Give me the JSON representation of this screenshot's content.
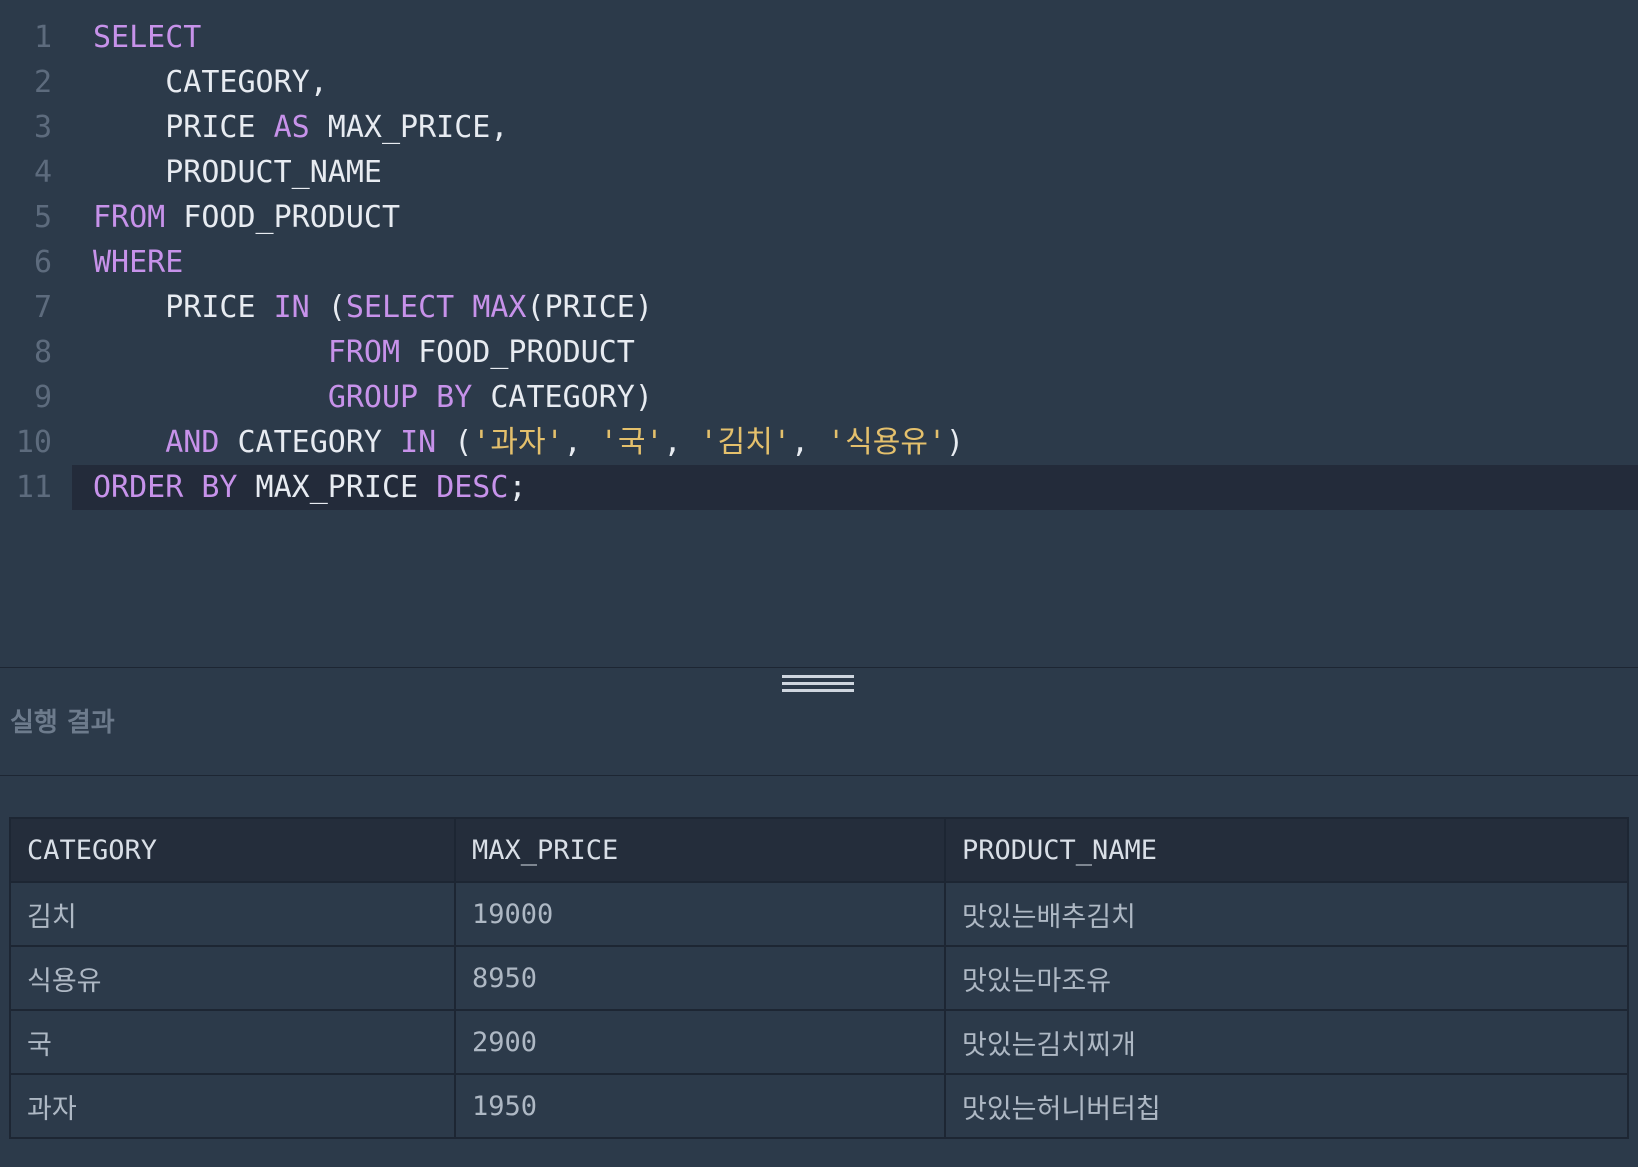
{
  "editor": {
    "lines": [
      {
        "no": "1",
        "tokens": [
          {
            "t": "SELECT",
            "k": "kw"
          }
        ]
      },
      {
        "no": "2",
        "tokens": [
          {
            "t": "    CATEGORY,",
            "k": "plain"
          }
        ]
      },
      {
        "no": "3",
        "tokens": [
          {
            "t": "    PRICE ",
            "k": "plain"
          },
          {
            "t": "AS",
            "k": "kw"
          },
          {
            "t": " MAX_PRICE,",
            "k": "plain"
          }
        ]
      },
      {
        "no": "4",
        "tokens": [
          {
            "t": "    PRODUCT_NAME",
            "k": "plain"
          }
        ]
      },
      {
        "no": "5",
        "tokens": [
          {
            "t": "FROM",
            "k": "kw"
          },
          {
            "t": " FOOD_PRODUCT",
            "k": "plain"
          }
        ]
      },
      {
        "no": "6",
        "tokens": [
          {
            "t": "WHERE",
            "k": "kw"
          }
        ]
      },
      {
        "no": "7",
        "tokens": [
          {
            "t": "    PRICE ",
            "k": "plain"
          },
          {
            "t": "IN",
            "k": "kw"
          },
          {
            "t": " (",
            "k": "plain"
          },
          {
            "t": "SELECT",
            "k": "kw"
          },
          {
            "t": " ",
            "k": "plain"
          },
          {
            "t": "MAX",
            "k": "kw"
          },
          {
            "t": "(PRICE)",
            "k": "plain"
          }
        ]
      },
      {
        "no": "8",
        "tokens": [
          {
            "t": "             ",
            "k": "plain"
          },
          {
            "t": "FROM",
            "k": "kw"
          },
          {
            "t": " FOOD_PRODUCT",
            "k": "plain"
          }
        ]
      },
      {
        "no": "9",
        "tokens": [
          {
            "t": "             ",
            "k": "plain"
          },
          {
            "t": "GROUP BY",
            "k": "kw"
          },
          {
            "t": " CATEGORY)",
            "k": "plain"
          }
        ]
      },
      {
        "no": "10",
        "tokens": [
          {
            "t": "    ",
            "k": "plain"
          },
          {
            "t": "AND",
            "k": "kw"
          },
          {
            "t": " CATEGORY ",
            "k": "plain"
          },
          {
            "t": "IN",
            "k": "kw"
          },
          {
            "t": " (",
            "k": "plain"
          },
          {
            "t": "'과자'",
            "k": "str"
          },
          {
            "t": ", ",
            "k": "plain"
          },
          {
            "t": "'국'",
            "k": "str"
          },
          {
            "t": ", ",
            "k": "plain"
          },
          {
            "t": "'김치'",
            "k": "str"
          },
          {
            "t": ", ",
            "k": "plain"
          },
          {
            "t": "'식용유'",
            "k": "str"
          },
          {
            "t": ")",
            "k": "plain"
          }
        ]
      },
      {
        "no": "11",
        "tokens": [
          {
            "t": "ORDER BY",
            "k": "kw"
          },
          {
            "t": " MAX_PRICE ",
            "k": "plain"
          },
          {
            "t": "DESC",
            "k": "kw"
          },
          {
            "t": ";",
            "k": "plain"
          }
        ]
      }
    ],
    "colors": {
      "keyword": "#c792ea",
      "string": "#e4c06c",
      "plain": "#e7ebf1",
      "line_number": "#5d6b7d"
    }
  },
  "result_panel": {
    "title": "실행 결과"
  },
  "result_table": {
    "columns": [
      "CATEGORY",
      "MAX_PRICE",
      "PRODUCT_NAME"
    ],
    "rows": [
      [
        "김치",
        "19000",
        "맛있는배추김치"
      ],
      [
        "식용유",
        "8950",
        "맛있는마조유"
      ],
      [
        "국",
        "2900",
        "맛있는김치찌개"
      ],
      [
        "과자",
        "1950",
        "맛있는허니버터칩"
      ]
    ]
  }
}
